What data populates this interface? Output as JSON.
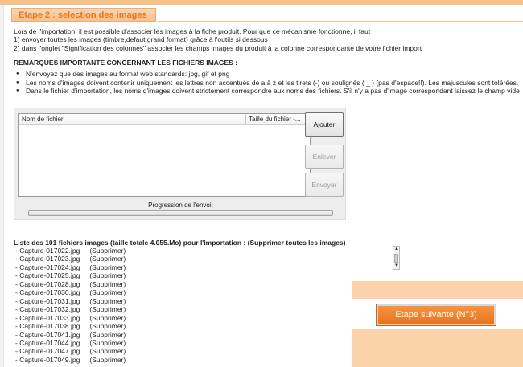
{
  "step": {
    "title": "Etape 2 : selection des images"
  },
  "intro": {
    "lines": [
      "Lors de l'importation, il est possible d'associer les images à la fiche produit. Pour que ce mécanisme fonctionne, il faut :",
      "1) envoyer toutes les images (timbre,defaut,grand format) grâce à l'outils si dessous",
      "2) dans l'onglet \"Signification des colonnes\" associer les champs images du produit à la colonne correspondante de votre fichier import"
    ]
  },
  "remarks": {
    "title": "REMARQUES IMPORTANTE CONCERNANT LES FICHIERS IMAGES :",
    "items": [
      "N'envoyez que des images au format web standards: jpg, gif et png",
      "Les noms d'images doivent contenir uniquement les lettres non accentués de a à z et les tirets (-) ou soulignés ( _ ) (pas d'espace!!). Les majuscules sont tolérées.",
      "Dans le fichier d'importation, les noms d'images doivent strictement correspondre aux noms des fichiers. S'il n'y a pas d'image correspondant laissez le champ vide"
    ]
  },
  "uploader": {
    "col_name": "Nom de fichier",
    "col_size": "Taille du fichier -...",
    "add_label": "Ajouter",
    "remove_label": "Enlever",
    "send_label": "Envoyer",
    "progress_label": "Progression de l'envoi:",
    "progress": 0
  },
  "files": {
    "title": "Liste des 101 fichiers images (taille totale 4.055.Mo) pour l'importation :  (Supprimer toutes les images)",
    "delete_label": "(Supprimer)",
    "items": [
      "- Capture-017022.jpg",
      "- Capture-017023.jpg",
      "- Capture-017024.jpg",
      "- Capture-017025.jpg",
      "- Capture-017028.jpg",
      "- Capture-017030.jpg",
      "- Capture-017031.jpg",
      "- Capture-017032.jpg",
      "- Capture-017033.jpg",
      "- Capture-017038.jpg",
      "- Capture-017041.jpg",
      "- Capture-017044.jpg",
      "- Capture-017047.jpg",
      "- Capture-017049.jpg"
    ]
  },
  "next": {
    "label": "Etape suivante (N°3)"
  },
  "colors": {
    "accent": "#ea7320",
    "header_bg": "#f4c291",
    "panel_bg": "#fbd2a9"
  }
}
